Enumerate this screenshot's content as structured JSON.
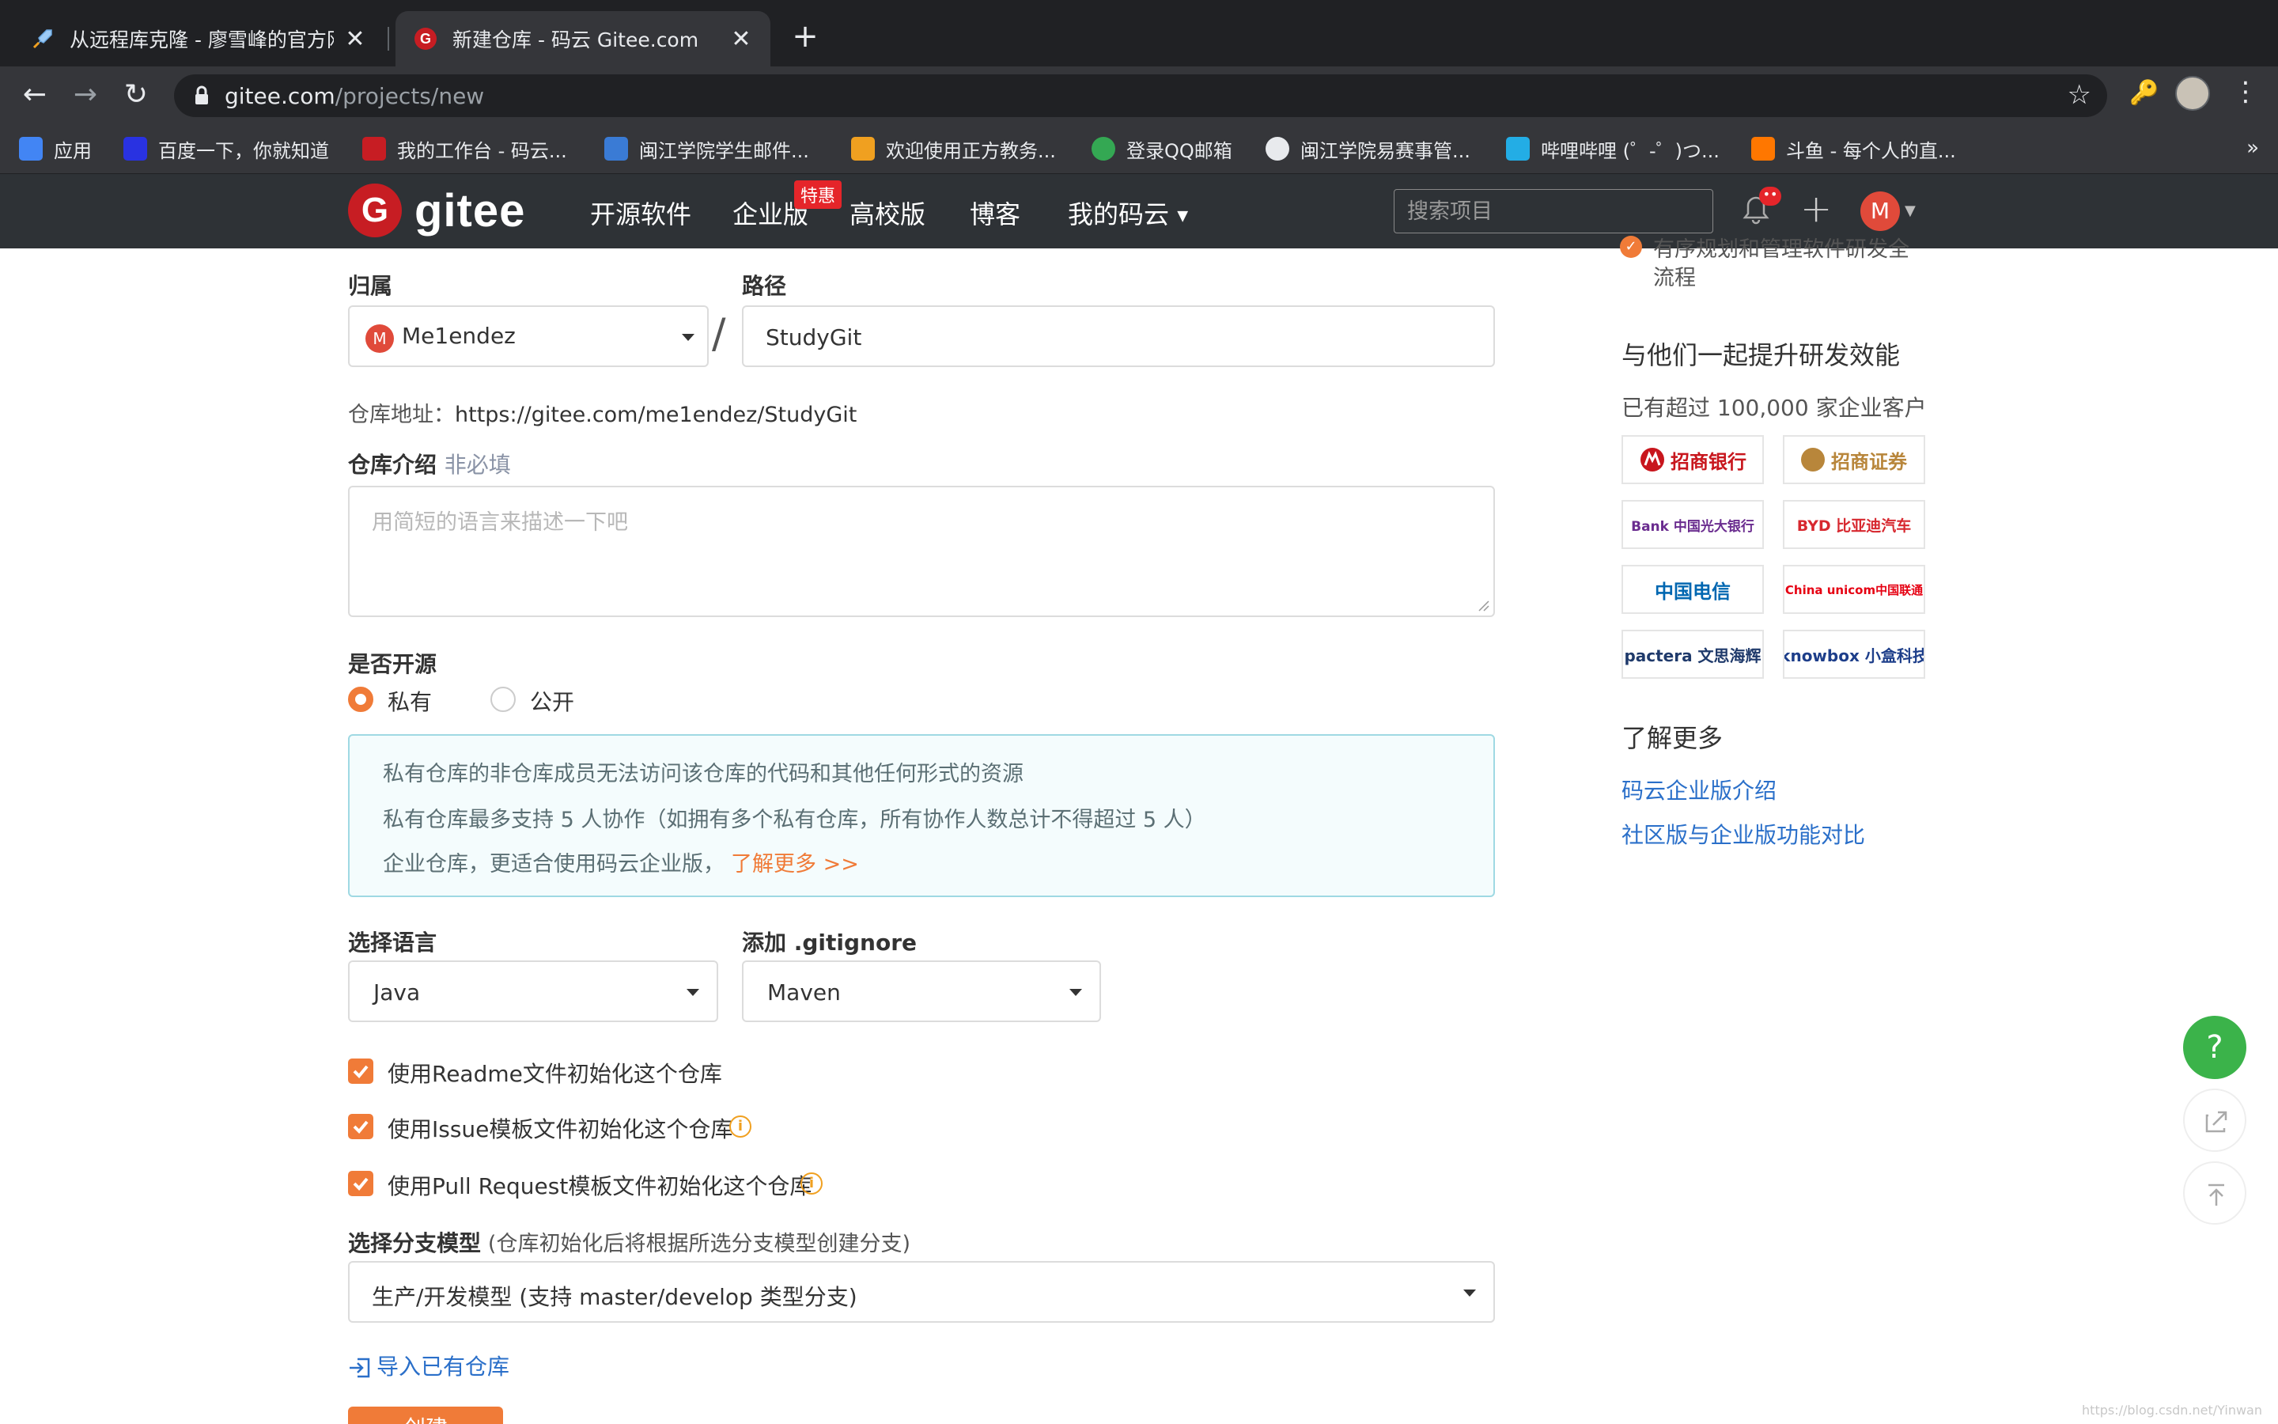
{
  "browser": {
    "tabs": [
      {
        "title": "从远程库克隆 - 廖雪峰的官方网站",
        "active": false
      },
      {
        "title": "新建仓库 - 码云 Gitee.com",
        "active": true
      }
    ],
    "url_domain": "gitee.com",
    "url_path": "/projects/new",
    "bookmarks": [
      {
        "label": "应用",
        "icon": "apps-grid-icon",
        "color": "#4285f4"
      },
      {
        "label": "百度一下，你就知道",
        "icon": "baidu-icon",
        "color": "#2932e1"
      },
      {
        "label": "我的工作台 - 码云...",
        "icon": "gitee-icon",
        "color": "#c71d23"
      },
      {
        "label": "闽江学院学生邮件...",
        "icon": "mail-icon",
        "color": "#3a7bd5"
      },
      {
        "label": "欢迎使用正方教务...",
        "icon": "box-icon",
        "color": "#f0a020"
      },
      {
        "label": "登录QQ邮箱",
        "icon": "chrome-icon",
        "color": "#34a853"
      },
      {
        "label": "闽江学院易赛事管...",
        "icon": "globe-icon",
        "color": "#e8eaed"
      },
      {
        "label": "哔哩哔哩 (゜-゜)つ...",
        "icon": "bilibili-icon",
        "color": "#23ade5"
      },
      {
        "label": "斗鱼 - 每个人的直...",
        "icon": "douyu-icon",
        "color": "#ff7700"
      }
    ],
    "more": "»"
  },
  "header": {
    "logo_text": "gitee",
    "logo_mark": "G",
    "nav": [
      "开源软件",
      "企业版",
      "高校版",
      "博客",
      "我的码云"
    ],
    "hot_badge": "特惠",
    "search_placeholder": "搜索项目",
    "notification_count": "••",
    "avatar_letter": "M"
  },
  "form": {
    "owner_label": "归属",
    "owner_value": "Me1endez",
    "owner_avatar": "M",
    "slash": "/",
    "path_label": "路径",
    "path_value": "StudyGit",
    "repo_address_label": "仓库地址：",
    "repo_address": "https://gitee.com/me1endez/StudyGit",
    "intro_label": "仓库介绍",
    "intro_optional": "非必填",
    "intro_placeholder": "用简短的语言来描述一下吧",
    "open_source_label": "是否开源",
    "visibility_options": [
      "私有",
      "公开"
    ],
    "visibility_selected": "私有",
    "notice_lines": [
      "私有仓库的非仓库成员无法访问该仓库的代码和其他任何形式的资源",
      "私有仓库最多支持 5 人协作（如拥有多个私有仓库，所有协作人数总计不得超过 5 人）",
      "企业仓库，更适合使用码云企业版，"
    ],
    "notice_link": "了解更多 >>",
    "language_label": "选择语言",
    "language_value": "Java",
    "gitignore_label": "添加 .gitignore",
    "gitignore_value": "Maven",
    "checkboxes": [
      {
        "label": "使用Readme文件初始化这个仓库",
        "checked": true,
        "info": false
      },
      {
        "label": "使用Issue模板文件初始化这个仓库",
        "checked": true,
        "info": true
      },
      {
        "label": "使用Pull Request模板文件初始化这个仓库",
        "checked": true,
        "info": true
      }
    ],
    "branch_label": "选择分支模型",
    "branch_hint": "(仓库初始化后将根据所选分支模型创建分支)",
    "branch_value": "生产/开发模型 (支持 master/develop 类型分支)",
    "import_label": "导入已有仓库",
    "create_button": "创建"
  },
  "sidebar": {
    "top_item": "有序规划和管理软件研发全流程",
    "heading": "与他们一起提升研发效能",
    "customers": "已有超过 100,000 家企业客户",
    "logos": [
      {
        "name": "招商银行",
        "color": "#c8161d"
      },
      {
        "name": "招商证券",
        "color": "#b8863b"
      },
      {
        "name": "Bank 中国光大银行",
        "color": "#6a2c8f"
      },
      {
        "name": "BYD 比亚迪汽车",
        "color": "#d7282f"
      },
      {
        "name": "中国电信",
        "color": "#0067b1"
      },
      {
        "name": "China unicom中国联通",
        "color": "#e60012"
      },
      {
        "name": "pactera 文思海辉",
        "color": "#1f3a6b"
      },
      {
        "name": "knowbox 小盒科技",
        "color": "#1d3e8a"
      }
    ],
    "learn_more_heading": "了解更多",
    "links": [
      "码云企业版介绍",
      "社区版与企业版功能对比"
    ]
  },
  "floating": {
    "help": "?"
  },
  "watermark": "https://blog.csdn.net/Yinwan",
  "colors": {
    "accent": "#f07b38",
    "brand": "#c71d23",
    "header_bg": "#2e3236",
    "link": "#2a6fc9"
  }
}
